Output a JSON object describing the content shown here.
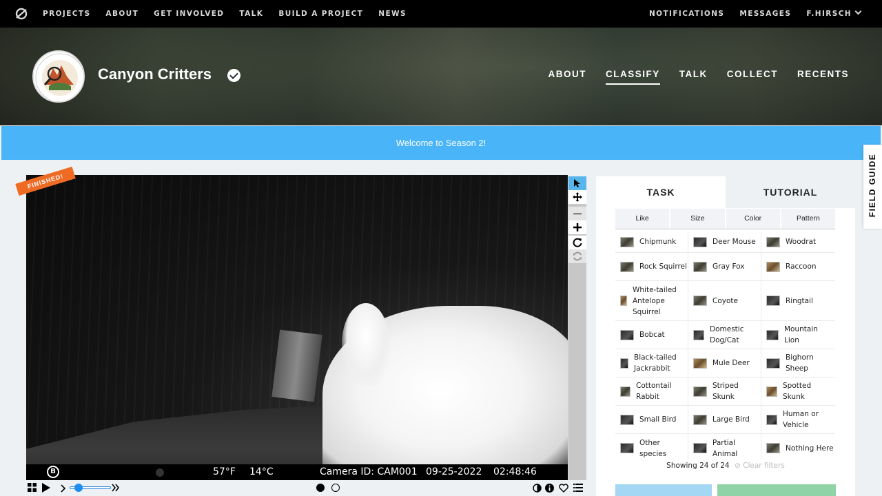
{
  "topbar": {
    "logo_icon": "zooniverse-logo-icon",
    "nav": [
      "PROJECTS",
      "ABOUT",
      "GET INVOLVED",
      "TALK",
      "BUILD A PROJECT",
      "NEWS"
    ],
    "notifications": "NOTIFICATIONS",
    "messages": "MESSAGES",
    "user": "F.HIRSCH"
  },
  "project": {
    "title": "Canyon Critters",
    "nav": [
      "ABOUT",
      "CLASSIFY",
      "TALK",
      "COLLECT",
      "RECENTS"
    ],
    "active_nav": "CLASSIFY"
  },
  "banner": {
    "text": "Welcome to Season 2!"
  },
  "subject": {
    "badge": "FINISHED!",
    "camera_logo": "B",
    "temp_f": "57°F",
    "temp_c": "14°C",
    "camera_id": "Camera ID: CAM001",
    "date": "09-25-2022",
    "time": "02:48:46"
  },
  "task_panel": {
    "tabs": [
      "TASK",
      "TUTORIAL"
    ],
    "filters": [
      "Like",
      "Size",
      "Color",
      "Pattern"
    ],
    "choices": [
      [
        "Chipmunk",
        "Deer Mouse",
        "Woodrat"
      ],
      [
        "Rock Squirrel",
        "Gray Fox",
        "Raccoon"
      ],
      [
        "White-tailed Antelope Squirrel",
        "Coyote",
        "Ringtail"
      ],
      [
        "Bobcat",
        "Domestic Dog/Cat",
        "Mountain Lion"
      ],
      [
        "Black-tailed Jackrabbit",
        "Mule Deer",
        "Bighorn Sheep"
      ],
      [
        "Cottontail Rabbit",
        "Striped Skunk",
        "Spotted Skunk"
      ],
      [
        "Small Bird",
        "Large Bird",
        "Human or Vehicle"
      ],
      [
        "Other species",
        "Partial Animal",
        "Nothing Here"
      ]
    ],
    "showing": "Showing 24 of 24",
    "clear_filters": "Clear filters"
  },
  "field_guide": {
    "label": "FIELD GUIDE"
  },
  "colors": {
    "banner": "#49b4f8",
    "finished_badge": "#ef6a23",
    "tool_selected": "#57b5ec",
    "done_button": "#a4d7f4",
    "next_button": "#8fd3a7"
  }
}
